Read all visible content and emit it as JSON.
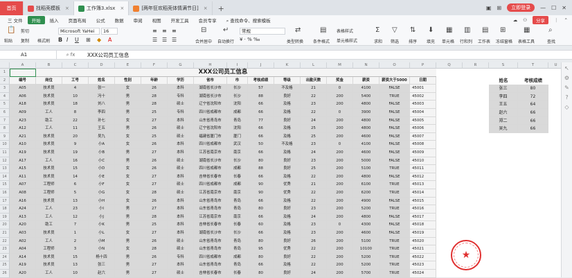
{
  "tabs": [
    {
      "label": "首页",
      "kind": "home"
    },
    {
      "label": "找稻壳模板",
      "color": "#e54b4b"
    },
    {
      "label": "工作簿3.xlsx",
      "color": "#2f8f4f",
      "active": true
    },
    {
      "label": "[两年狂欢稻壳体情满节日]",
      "color": "#f08030"
    }
  ],
  "tab_add": "+",
  "login_label": "立即登录",
  "menu": [
    "三 文件",
    "开始",
    "插入",
    "页面布局",
    "公式",
    "数据",
    "审阅",
    "视图",
    "开发工具",
    "会员专享",
    "查找命令、搜索模板"
  ],
  "share_label": "分享",
  "ribbon": {
    "paste": "粘贴",
    "cut": "剪切",
    "copy": "复制",
    "format_painter": "格式刷",
    "font_name": "Microsoft YaHei",
    "font_size": "16",
    "merge": "合并居中",
    "wrap": "自动换行",
    "number_format": "常规",
    "type_convert": "类型转换",
    "cond_format": "条件格式",
    "table_style": "表格样式",
    "cell_style": "单元格样式",
    "sum": "求和",
    "filter": "筛选",
    "sort": "排序",
    "fill": "填充",
    "single_cell": "单元格",
    "row_col": "行和列",
    "worksheet": "工作表",
    "freeze": "冻结窗格",
    "table_tools": "表格工具",
    "find": "查找"
  },
  "formula": {
    "name_box": "A1",
    "content": "XXX公司员工信息"
  },
  "columns": [
    "A",
    "B",
    "C",
    "D",
    "E",
    "F",
    "G",
    "H",
    "I",
    "J",
    "K",
    "L",
    "M",
    "N",
    "O",
    "P",
    "Q",
    "R",
    "S",
    "T",
    "U"
  ],
  "sheet_title": "XXX公司员工信息",
  "headers": [
    "编号",
    "岗位",
    "工号",
    "姓名",
    "性别",
    "年龄",
    "学历",
    "省市",
    "市",
    "考核成绩",
    "等级",
    "出勤天数",
    "奖金",
    "薪资",
    "薪资大于5000",
    "日期"
  ],
  "rows": [
    [
      "A05",
      "技术员",
      "4",
      "张一",
      "女",
      "26",
      "本科",
      "湖南省长沙市",
      "长沙",
      "57",
      "不及格",
      "21",
      "0",
      "4100",
      "FALSE",
      "45001"
    ],
    [
      "A06",
      "技术员",
      "10",
      "冯十",
      "男",
      "28",
      "专科",
      "湖南省长沙市",
      "长沙",
      "88",
      "良好",
      "22",
      "200",
      "5400",
      "TRUE",
      "45002"
    ],
    [
      "A18",
      "技术员",
      "18",
      "刘八",
      "男",
      "28",
      "硕士",
      "辽宁省沈阳市",
      "沈阳",
      "66",
      "及格",
      "23",
      "200",
      "4800",
      "FALSE",
      "45003"
    ],
    [
      "A09",
      "工人",
      "8",
      "李四",
      "男",
      "25",
      "专科",
      "四川省成都市",
      "成都",
      "66",
      "及格",
      "22",
      "0",
      "3900",
      "FALSE",
      "45004"
    ],
    [
      "A23",
      "助工",
      "22",
      "孙七",
      "女",
      "27",
      "本科",
      "山东省青岛市",
      "青岛",
      "77",
      "良好",
      "24",
      "200",
      "4800",
      "FALSE",
      "45005"
    ],
    [
      "A12",
      "工人",
      "11",
      "王五",
      "男",
      "26",
      "硕士",
      "辽宁省沈阳市",
      "沈阳",
      "66",
      "及格",
      "25",
      "200",
      "4800",
      "FALSE",
      "45006"
    ],
    [
      "A21",
      "技术员",
      "20",
      "吴九",
      "女",
      "25",
      "硕士",
      "福建省厦门市",
      "厦门",
      "66",
      "及格",
      "25",
      "200",
      "4600",
      "FALSE",
      "45007"
    ],
    [
      "A10",
      "技术员",
      "9",
      "小A",
      "女",
      "26",
      "本科",
      "四川省成都市",
      "武汉",
      "50",
      "不及格",
      "23",
      "0",
      "4100",
      "FALSE",
      "45008"
    ],
    [
      "A19",
      "技术员",
      "19",
      "小B",
      "男",
      "27",
      "本科",
      "江苏省南京市",
      "南京",
      "66",
      "及格",
      "24",
      "200",
      "4600",
      "FALSE",
      "45009"
    ],
    [
      "A17",
      "工人",
      "16",
      "小C",
      "男",
      "26",
      "硕士",
      "湖南省长沙市",
      "长沙",
      "80",
      "良好",
      "23",
      "200",
      "5000",
      "FALSE",
      "45010"
    ],
    [
      "A15",
      "技术员",
      "15",
      "小D",
      "女",
      "26",
      "硕士",
      "四川省成都市",
      "成都",
      "88",
      "良好",
      "25",
      "200",
      "5100",
      "TRUE",
      "45011"
    ],
    [
      "A11",
      "技术员",
      "14",
      "小E",
      "女",
      "27",
      "本科",
      "吉林省长春市",
      "长春",
      "66",
      "及格",
      "22",
      "200",
      "4800",
      "FALSE",
      "45012"
    ],
    [
      "A07",
      "工程师",
      "6",
      "小F",
      "女",
      "27",
      "硕士",
      "四川省成都市",
      "成都",
      "90",
      "优秀",
      "21",
      "200",
      "6100",
      "TRUE",
      "45013"
    ],
    [
      "A08",
      "工程师",
      "5",
      "小G",
      "女",
      "28",
      "硕士",
      "江苏省南京市",
      "南京",
      "90",
      "优秀",
      "22",
      "200",
      "6200",
      "TRUE",
      "45014"
    ],
    [
      "A16",
      "技术员",
      "13",
      "小H",
      "女",
      "26",
      "本科",
      "山东省青岛市",
      "青岛",
      "66",
      "及格",
      "22",
      "200",
      "4900",
      "FALSE",
      "45015"
    ],
    [
      "A24",
      "工人",
      "23",
      "小I",
      "男",
      "27",
      "本科",
      "山东省青岛市",
      "青岛",
      "80",
      "良好",
      "23",
      "200",
      "5200",
      "TRUE",
      "45016"
    ],
    [
      "A13",
      "工人",
      "12",
      "小J",
      "男",
      "28",
      "本科",
      "江苏省南京市",
      "南京",
      "66",
      "及格",
      "24",
      "200",
      "4800",
      "FALSE",
      "45017"
    ],
    [
      "A20",
      "助工",
      "7",
      "小K",
      "男",
      "25",
      "本科",
      "吉林省长春市",
      "长春",
      "60",
      "及格",
      "23",
      "0",
      "4300",
      "FALSE",
      "45018"
    ],
    [
      "A03",
      "技术员",
      "1",
      "小L",
      "女",
      "27",
      "本科",
      "湖南省长沙市",
      "长沙",
      "66",
      "及格",
      "23",
      "200",
      "4600",
      "FALSE",
      "45019"
    ],
    [
      "A02",
      "工人",
      "2",
      "小M",
      "男",
      "26",
      "硕士",
      "山东省青岛市",
      "青岛",
      "80",
      "良好",
      "26",
      "200",
      "5100",
      "TRUE",
      "45020"
    ],
    [
      "A04",
      "工程师",
      "3",
      "小N",
      "女",
      "28",
      "硕士",
      "山东省青岛市",
      "青岛",
      "95",
      "优秀",
      "22",
      "200",
      "10100",
      "TRUE",
      "45021"
    ],
    [
      "A14",
      "技术员",
      "15",
      "杨十四",
      "男",
      "26",
      "专科",
      "四川省成都市",
      "成都",
      "80",
      "良好",
      "22",
      "200",
      "5200",
      "TRUE",
      "45022"
    ],
    [
      "A19",
      "技术员",
      "13",
      "张三",
      "男",
      "27",
      "本科",
      "山东省青岛市",
      "青岛",
      "66",
      "及格",
      "22",
      "200",
      "5200",
      "TRUE",
      "45023"
    ],
    [
      "A20",
      "工人",
      "10",
      "赵六",
      "男",
      "27",
      "硕士",
      "吉林省长春市",
      "长春",
      "80",
      "良好",
      "24",
      "200",
      "5700",
      "TRUE",
      "45024"
    ]
  ],
  "side_table": {
    "headers": [
      "姓名",
      "考核成绩"
    ],
    "rows": [
      [
        "张三",
        "80"
      ],
      [
        "李四",
        "72"
      ],
      [
        "王五",
        "64"
      ],
      [
        "赵六",
        "66"
      ],
      [
        "郑二",
        "66"
      ],
      [
        "吴九",
        "66"
      ]
    ]
  }
}
